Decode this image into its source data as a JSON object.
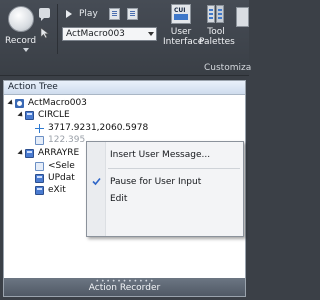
{
  "ribbon": {
    "record_label": "Record",
    "play_label": "Play",
    "macro_dropdown_value": "ActMacro003",
    "cui_icon_text": "CUI",
    "user_interface_label": [
      "User",
      "Interface"
    ],
    "tool_palettes_label": [
      "Tool",
      "Palettes"
    ],
    "customization_tab": "Customiza"
  },
  "panel": {
    "title": "Action Tree",
    "status_label": "Action Recorder",
    "grip": "• • • • • • • • • • •"
  },
  "tree": {
    "root": "ActMacro003",
    "circle": "CIRCLE",
    "point": "3717.9231,2060.5978",
    "radius": "122.395",
    "arrayrect": "ARRAYRE",
    "select": "<Sele",
    "update": "UPdat",
    "exit": "eXit"
  },
  "context_menu": {
    "items": [
      "Insert User Message...",
      "Pause for User Input",
      "Edit"
    ],
    "checked_item": "Pause for User Input"
  },
  "colors": {
    "ribbon_bg": "#3b4047",
    "panel_header": "#d6e3f2",
    "status_bar": "#5c6672",
    "check_color": "#2f66c7"
  }
}
